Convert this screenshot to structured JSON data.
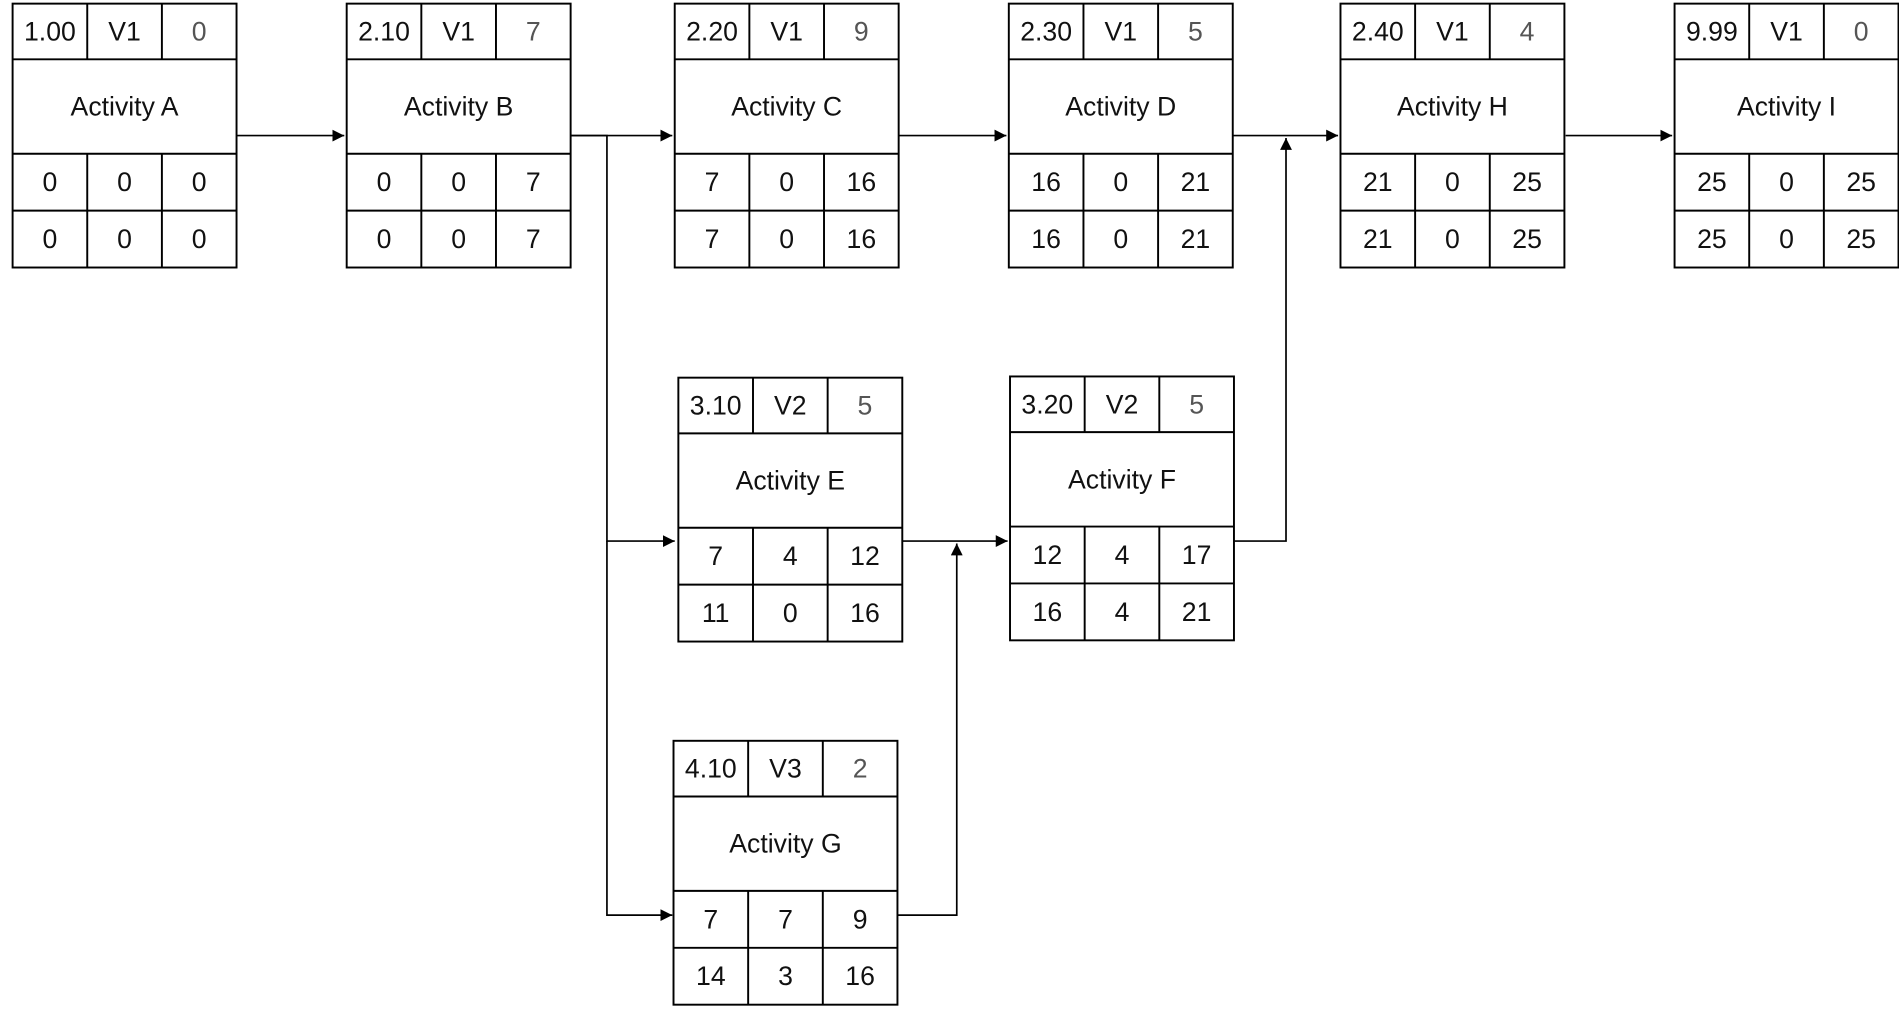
{
  "diagram": {
    "nodes": [
      {
        "key": "A",
        "id": "1.00",
        "version": "V1",
        "duration": "0",
        "name": "Activity A",
        "row1": [
          "0",
          "0",
          "0"
        ],
        "row2": [
          "0",
          "0",
          "0"
        ]
      },
      {
        "key": "B",
        "id": "2.10",
        "version": "V1",
        "duration": "7",
        "name": "Activity B",
        "row1": [
          "0",
          "0",
          "7"
        ],
        "row2": [
          "0",
          "0",
          "7"
        ]
      },
      {
        "key": "C",
        "id": "2.20",
        "version": "V1",
        "duration": "9",
        "name": "Activity C",
        "row1": [
          "7",
          "0",
          "16"
        ],
        "row2": [
          "7",
          "0",
          "16"
        ]
      },
      {
        "key": "D",
        "id": "2.30",
        "version": "V1",
        "duration": "5",
        "name": "Activity D",
        "row1": [
          "16",
          "0",
          "21"
        ],
        "row2": [
          "16",
          "0",
          "21"
        ]
      },
      {
        "key": "H",
        "id": "2.40",
        "version": "V1",
        "duration": "4",
        "name": "Activity H",
        "row1": [
          "21",
          "0",
          "25"
        ],
        "row2": [
          "21",
          "0",
          "25"
        ]
      },
      {
        "key": "I",
        "id": "9.99",
        "version": "V1",
        "duration": "0",
        "name": "Activity I",
        "row1": [
          "25",
          "0",
          "25"
        ],
        "row2": [
          "25",
          "0",
          "25"
        ]
      },
      {
        "key": "E",
        "id": "3.10",
        "version": "V2",
        "duration": "5",
        "name": "Activity E",
        "row1": [
          "7",
          "4",
          "12"
        ],
        "row2": [
          "11",
          "0",
          "16"
        ]
      },
      {
        "key": "F",
        "id": "3.20",
        "version": "V2",
        "duration": "5",
        "name": "Activity F",
        "row1": [
          "12",
          "4",
          "17"
        ],
        "row2": [
          "16",
          "4",
          "21"
        ]
      },
      {
        "key": "G",
        "id": "4.10",
        "version": "V3",
        "duration": "2",
        "name": "Activity G",
        "row1": [
          "7",
          "7",
          "9"
        ],
        "row2": [
          "14",
          "3",
          "16"
        ]
      }
    ],
    "edges": [
      {
        "from": "A",
        "to": "B"
      },
      {
        "from": "B",
        "to": "C"
      },
      {
        "from": "C",
        "to": "D"
      },
      {
        "from": "D",
        "to": "H"
      },
      {
        "from": "H",
        "to": "I"
      },
      {
        "from": "B",
        "to": "E"
      },
      {
        "from": "B",
        "to": "G"
      },
      {
        "from": "E",
        "to": "F"
      },
      {
        "from": "G",
        "to": "F"
      },
      {
        "from": "F",
        "to": "H"
      }
    ],
    "colors": {
      "line": "#000000",
      "duration_text": "#555555"
    }
  }
}
